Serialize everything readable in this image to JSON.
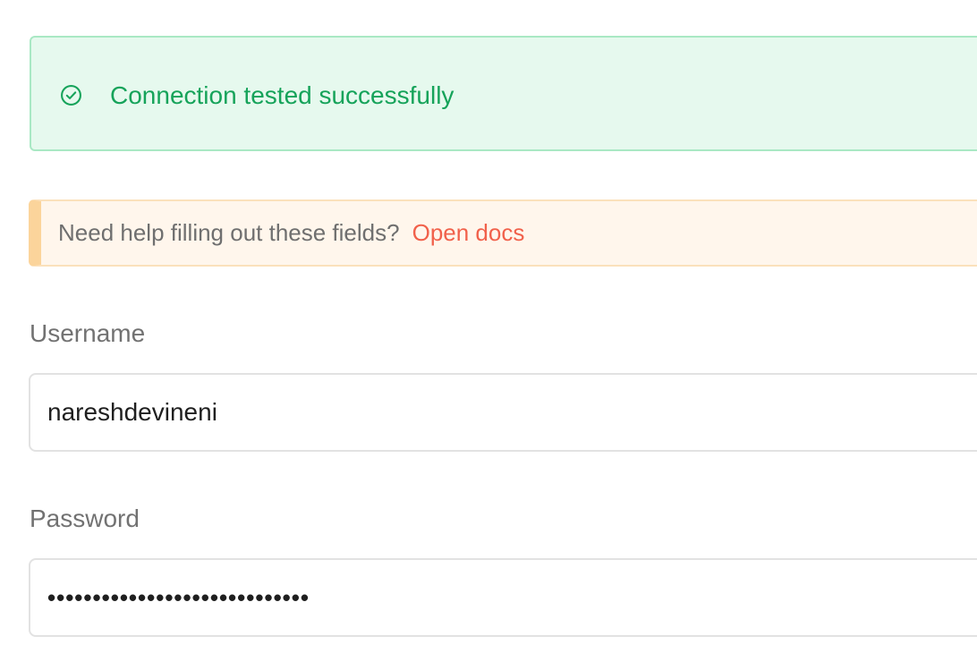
{
  "success_banner": {
    "icon": "check-circle-icon",
    "message": "Connection tested successfully",
    "color": "#16a35a"
  },
  "help_banner": {
    "text": "Need help filling out these fields?",
    "link_label": "Open docs",
    "link_color": "#f1614b"
  },
  "form": {
    "username": {
      "label": "Username",
      "value": "nareshdevineni"
    },
    "password": {
      "label": "Password",
      "value": "•••••••••••••••••••••••••••••"
    }
  }
}
